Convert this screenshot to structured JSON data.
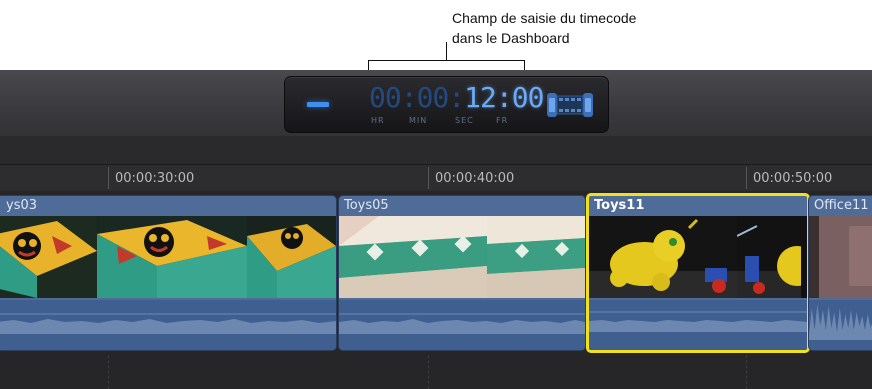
{
  "annotation": {
    "line1": "Champ de saisie du timecode",
    "line2": "dans le Dashboard"
  },
  "dashboard": {
    "timecode": {
      "hr": "00",
      "min": "00",
      "sec": "12",
      "fr": "00"
    },
    "unit_labels": {
      "hr": "HR",
      "min": "MIN",
      "sec": "SEC",
      "fr": "FR"
    },
    "accent_color": "#3d8ff0"
  },
  "ruler": {
    "labels": [
      "00:00:30:00",
      "00:00:40:00",
      "00:00:50:00"
    ]
  },
  "clips": [
    {
      "name": "ys03"
    },
    {
      "name": "Toys05"
    },
    {
      "name": "Toys11"
    },
    {
      "name": "Office11"
    }
  ],
  "colors": {
    "selection": "#f2e01d",
    "clip_blue": "#4f6c99"
  }
}
